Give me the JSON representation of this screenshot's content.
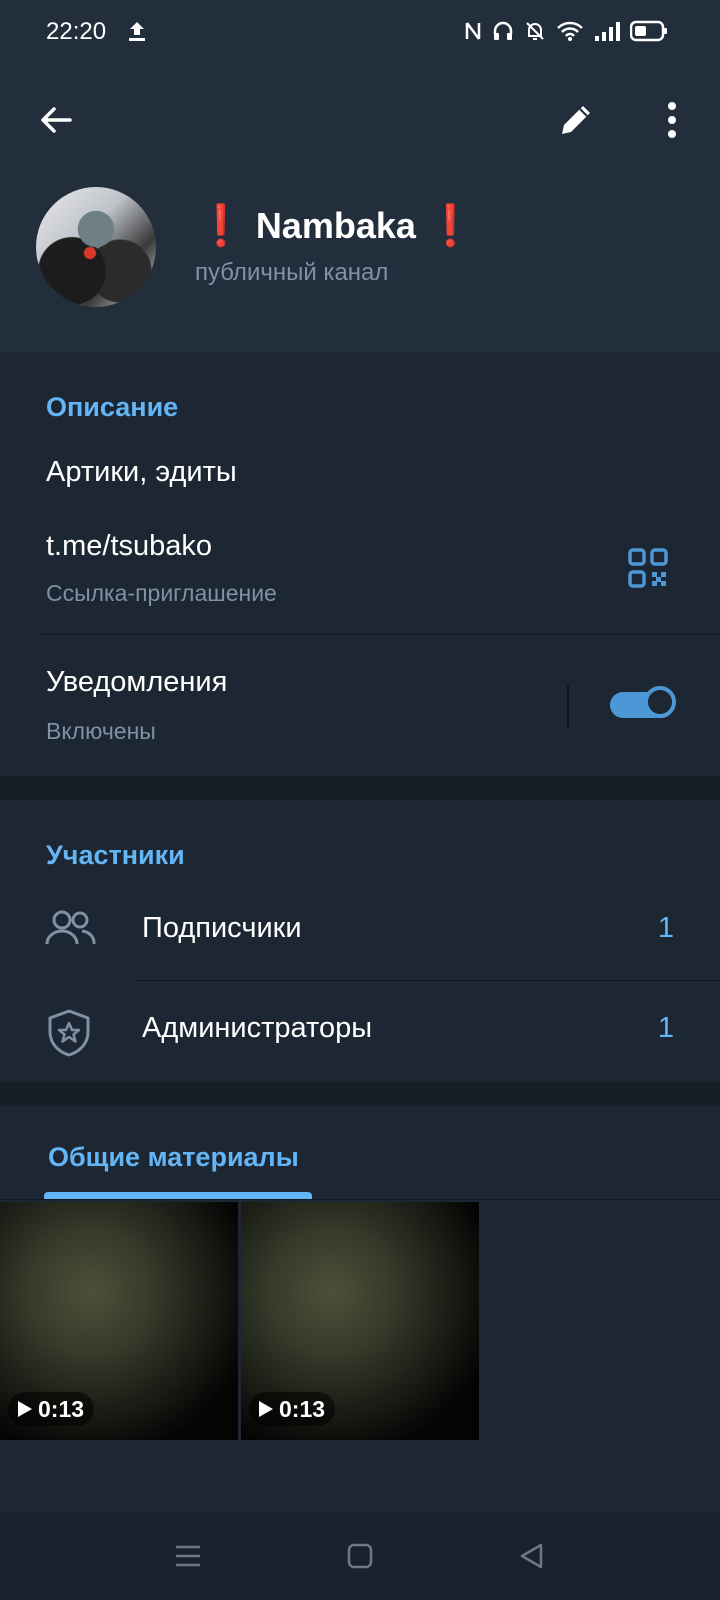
{
  "status_bar": {
    "time": "22:20",
    "icons": [
      "upload-icon",
      "nfc-icon",
      "headphones-icon",
      "bell-off-icon",
      "wifi-icon",
      "signal-icon",
      "battery-icon"
    ]
  },
  "header": {
    "channel_name": "Nambaka",
    "name_prefix_emoji": "❗",
    "name_suffix_emoji": "❗",
    "channel_type": "публичный канал"
  },
  "info": {
    "section_title": "Описание",
    "description": "Артики, эдиты",
    "link": "t.me/tsubako",
    "link_caption": "Ссылка-приглашение",
    "notifications_label": "Уведомления",
    "notifications_status": "Включены",
    "notifications_enabled": true
  },
  "members": {
    "section_title": "Участники",
    "items": [
      {
        "label": "Подписчики",
        "count": "1",
        "icon": "people-icon"
      },
      {
        "label": "Администраторы",
        "count": "1",
        "icon": "shield-star-icon"
      }
    ]
  },
  "shared_media": {
    "section_title": "Общие материалы",
    "items": [
      {
        "duration": "0:13",
        "type": "video"
      },
      {
        "duration": "0:13",
        "type": "video"
      }
    ]
  },
  "colors": {
    "accent": "#64b5f6",
    "background": "#1d2733",
    "header_background": "#232e3c",
    "secondary_text": "#7f91a4",
    "toggle_on": "#4c98d6",
    "exclamation": "#e53935"
  },
  "nav_bar": {
    "items": [
      "menu-icon",
      "home-square-icon",
      "back-triangle-icon"
    ]
  }
}
